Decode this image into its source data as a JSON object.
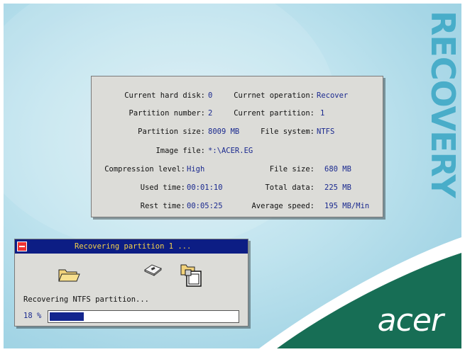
{
  "brand": {
    "vertical_text": "RECOVERY",
    "logo_text": "acer"
  },
  "info": {
    "current_hard_disk_label": "Current hard disk:",
    "current_hard_disk_value": "0",
    "current_operation_label": "Currnet operation:",
    "current_operation_value": "Recover",
    "partition_number_label": "Partition number:",
    "partition_number_value": "2",
    "current_partition_label": "Current partition:",
    "current_partition_value": "1",
    "partition_size_label": "Partition size:",
    "partition_size_value": "8009 MB",
    "file_system_label": "File system:",
    "file_system_value": "NTFS",
    "image_file_label": "Image file:",
    "image_file_value": "*:\\ACER.EG",
    "compression_level_label": "Compression level:",
    "compression_level_value": "High",
    "file_size_label": "File size:",
    "file_size_value": "680 MB",
    "used_time_label": "Used time:",
    "used_time_value": "00:01:10",
    "total_data_label": "Total data:",
    "total_data_value": "225 MB",
    "rest_time_label": "Rest time:",
    "rest_time_value": "00:05:25",
    "average_speed_label": "Average speed:",
    "average_speed_value": "195 MB/Min"
  },
  "dialog": {
    "title": "Recovering partition 1 ...",
    "status": "Recovering NTFS partition...",
    "percent_label": "18 %",
    "progress_fraction": 0.18
  },
  "icons": {
    "source": "folder-icon",
    "transfer": "disk-transfer-icon",
    "target": "folder-files-icon"
  },
  "colors": {
    "titlebar": "#0c1d84",
    "title_text": "#f4d14a",
    "value_text": "#1b2a8f",
    "progress_fill": "#14268e",
    "panel_bg": "#dcdcd8",
    "swoosh": "#176e55"
  }
}
